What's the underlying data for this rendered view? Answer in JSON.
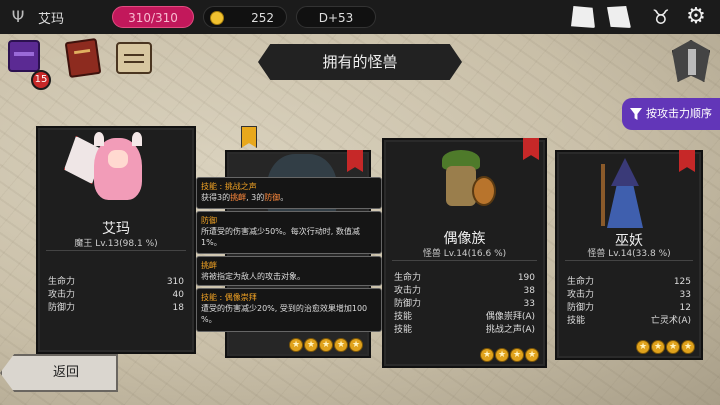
{
  "topbar": {
    "hero_name": "艾玛",
    "hp": "310/310",
    "gold": "252",
    "day": "D+53",
    "icons": [
      "card-icon",
      "map-icon",
      "demon-icon",
      "gear-icon"
    ]
  },
  "left_menu": {
    "chest_badge": "15"
  },
  "title": "拥有的怪兽",
  "sort_button": "按攻击力顺序",
  "cards": [
    {
      "name": "艾玛",
      "subtitle": "魔王 Lv.13(98.1 %)",
      "stats": [
        {
          "label": "生命力",
          "value": "310"
        },
        {
          "label": "攻击力",
          "value": "40"
        },
        {
          "label": "防御力",
          "value": "18"
        }
      ]
    },
    {
      "name": "偶像族",
      "subtitle": "怪兽 Lv.14(16.6 %)",
      "stats": [
        {
          "label": "生命力",
          "value": "190"
        },
        {
          "label": "攻击力",
          "value": "38"
        },
        {
          "label": "防御力",
          "value": "33"
        },
        {
          "label": "技能",
          "value": "偶像崇拜(A)"
        },
        {
          "label": "技能",
          "value": "挑战之声(A)"
        }
      ],
      "stars": 4
    },
    {
      "name": "巫妖",
      "subtitle": "怪兽 Lv.14(33.8 %)",
      "stats": [
        {
          "label": "生命力",
          "value": "125"
        },
        {
          "label": "攻击力",
          "value": "33"
        },
        {
          "label": "防御力",
          "value": "12"
        },
        {
          "label": "技能",
          "value": "亡灵术(A)"
        }
      ],
      "stars": 4
    }
  ],
  "hidden_card": {
    "stars": 5
  },
  "tooltips": [
    {
      "head": "技能 : 挑战之声",
      "body_pre": "获得3的",
      "hl1": "挑衅",
      "body_mid": ", 3的",
      "hl2": "防御",
      "body_post": "。"
    },
    {
      "head": "防御",
      "body": "所遭受的伤害减少50%。每次行动时, 数值减1%。"
    },
    {
      "head": "挑衅",
      "body": "将被指定为敌人的攻击对象。"
    },
    {
      "head": "技能 : 偶像崇拜",
      "body": "遭受的伤害减少20%, 受到的治愈效果增加100 %。"
    }
  ],
  "back_button": "返回"
}
